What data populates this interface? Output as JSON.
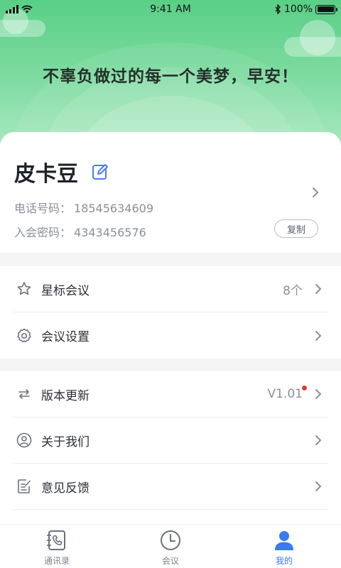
{
  "status_bar": {
    "time": "9:41 AM",
    "battery": "100%"
  },
  "greeting": "不辜负做过的每一个美梦，早安！",
  "profile": {
    "name": "皮卡豆",
    "phone_label": "电话号码：",
    "phone": "18545634609",
    "password_label": "入会密码：",
    "password": "4343456576",
    "copy_label": "复制"
  },
  "menu_group_1": [
    {
      "label": "星标会议",
      "value": "8个",
      "icon": "star-icon"
    },
    {
      "label": "会议设置",
      "value": "",
      "icon": "gear-icon"
    }
  ],
  "menu_group_2": [
    {
      "label": "版本更新",
      "value": "V1.01",
      "icon": "sync-icon",
      "badge": true
    },
    {
      "label": "关于我们",
      "value": "",
      "icon": "user-circle-icon"
    },
    {
      "label": "意见反馈",
      "value": "",
      "icon": "feedback-icon"
    }
  ],
  "tabbar": {
    "items": [
      {
        "label": "通讯录",
        "icon": "contacts-icon"
      },
      {
        "label": "会议",
        "icon": "clock-icon"
      },
      {
        "label": "我的",
        "icon": "person-icon",
        "active": true
      }
    ]
  },
  "colors": {
    "accent": "#3a7bf2",
    "hero_green": "#59cf86",
    "badge_red": "#e5383b",
    "text_secondary": "#8a8f99"
  }
}
